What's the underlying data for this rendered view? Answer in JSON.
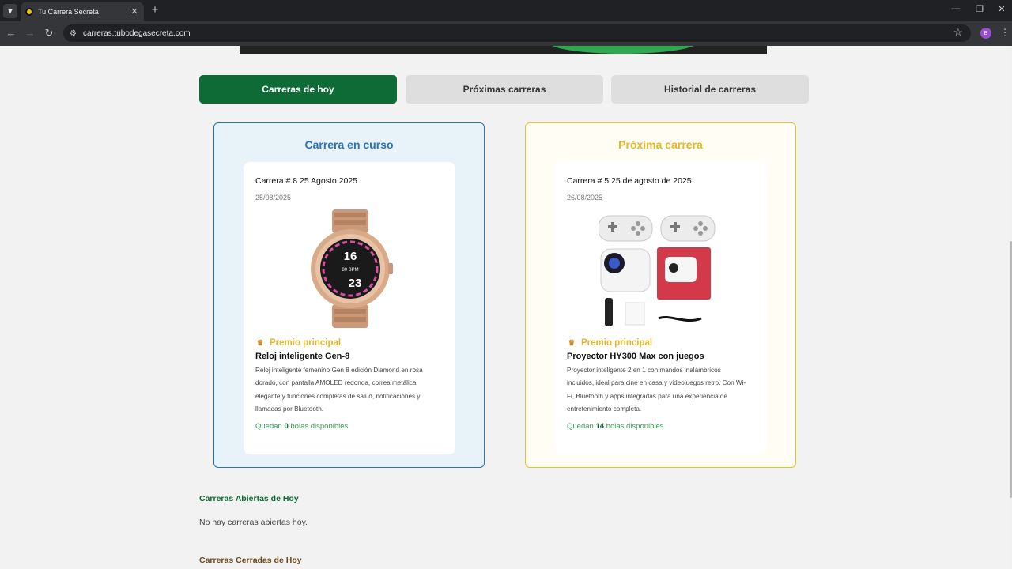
{
  "browser": {
    "tab_title": "Tu Carrera Secreta",
    "url": "carreras.tubodegasecreta.com",
    "profile_initial": "B",
    "icons": [
      "tab-list-icon",
      "tab-favicon",
      "close-icon",
      "plus-icon",
      "minimize-icon",
      "restore-icon",
      "window-close-icon",
      "back-icon",
      "forward-icon",
      "reload-icon",
      "site-info-icon",
      "star-icon",
      "menu-icon"
    ]
  },
  "race_tabs": [
    {
      "label": "Carreras de hoy",
      "active": true
    },
    {
      "label": "Próximas carreras",
      "active": false
    },
    {
      "label": "Historial de carreras",
      "active": false
    }
  ],
  "current_race": {
    "heading": "Carrera en curso",
    "title": "Carrera # 8 25 Agosto 2025",
    "date": "25/08/2025",
    "prize_label": "Premio principal",
    "prize_name": "Reloj inteligente Gen-8",
    "prize_description": "Reloj inteligente femenino Gen 8 edición Diamond en rosa dorado, con pantalla AMOLED redonda, correa metálica elegante y funciones completas de salud, notificaciones y llamadas por Bluetooth.",
    "balls_prefix": "Quedan",
    "balls_count": "0",
    "balls_suffix": "bolas disponibles",
    "watch_display": {
      "hour": "16",
      "minute": "23",
      "bpm": "80 BPM"
    }
  },
  "next_race": {
    "heading": "Próxima carrera",
    "title": "Carrera # 5 25 de agosto de 2025",
    "date": "26/08/2025",
    "prize_label": "Premio principal",
    "prize_name": "Proyector HY300 Max con juegos",
    "prize_description": "Proyector inteligente 2 en 1 con mandos inalámbricos incluidos, ideal para cine en casa y videojuegos retro. Con Wi-Fi, Bluetooth y apps integradas para una experiencia de entretenimiento completa.",
    "balls_prefix": "Quedan",
    "balls_count": "14",
    "balls_suffix": "bolas disponibles"
  },
  "open_today": {
    "heading": "Carreras Abiertas de Hoy",
    "empty_message": "No hay carreras abiertas hoy."
  },
  "closed_today": {
    "heading": "Carreras Cerradas de Hoy"
  },
  "colors": {
    "brand_green": "#0f6b35",
    "current_blue": "#2a73b4",
    "next_gold": "#e2b72a"
  }
}
